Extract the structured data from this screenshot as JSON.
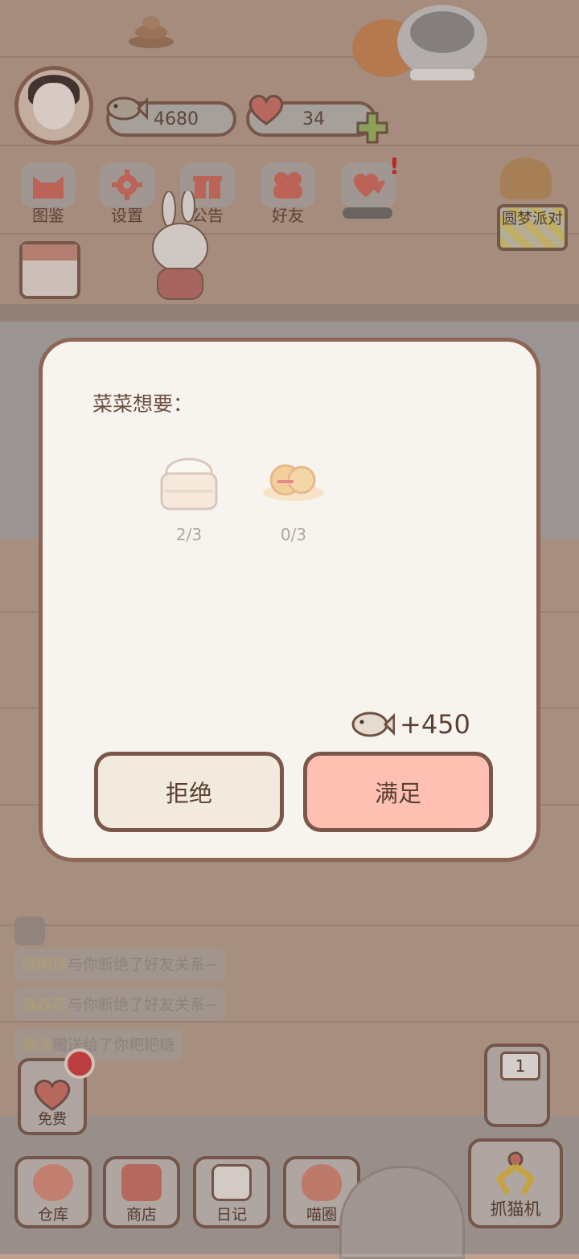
{
  "hud": {
    "fish_count": "4680",
    "heart_count": "34"
  },
  "menu": [
    {
      "label": "图鉴",
      "icon": "cat-face-icon"
    },
    {
      "label": "设置",
      "icon": "gear-icon"
    },
    {
      "label": "公告",
      "icon": "gift-icon"
    },
    {
      "label": "好友",
      "icon": "friends-icon"
    },
    {
      "label": "",
      "icon": "hearts-icon"
    }
  ],
  "party": {
    "label": "圆梦派对"
  },
  "dialog": {
    "title": "菜菜想要：",
    "items": [
      {
        "icon": "steamed-bun-basket-icon",
        "count": "2/3"
      },
      {
        "icon": "pastry-plate-icon",
        "count": "0/3"
      }
    ],
    "reward": "+450",
    "reject_label": "拒绝",
    "accept_label": "满足"
  },
  "chat": [
    {
      "name": "陆明璟",
      "text": "与你断绝了好友关系~"
    },
    {
      "name": "森森花",
      "text": "与你断绝了好友关系~"
    },
    {
      "name": "狼淮",
      "text": "赠送给了你粑粑糖"
    }
  ],
  "bottom": {
    "free_label": "免费",
    "nav": [
      {
        "label": "仓库",
        "icon": "bowl-icon"
      },
      {
        "label": "商店",
        "icon": "shop-icon"
      },
      {
        "label": "日记",
        "icon": "diary-icon"
      },
      {
        "label": "喵圈",
        "icon": "cat-planet-icon"
      }
    ],
    "machine_count": "1",
    "claw_label": "抓猫机"
  },
  "colors": {
    "dialog_bg": "#f7f4ef",
    "accept_button": "#ffc0b4",
    "reject_button": "#f2eadc",
    "border_brown": "#7a5748",
    "notification_red": "#d23a3a"
  }
}
